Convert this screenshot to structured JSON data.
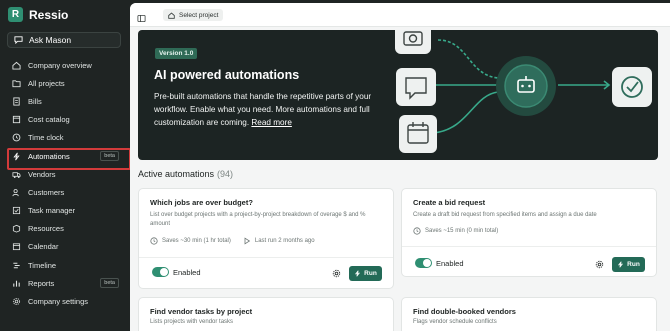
{
  "app": {
    "name": "Ressio",
    "logo_letter": "R",
    "accent": "#2f8f72"
  },
  "ask": {
    "label": "Ask Mason",
    "icon": "chat-icon"
  },
  "sidebar": {
    "items": [
      {
        "label": "Company overview",
        "icon": "home-icon"
      },
      {
        "label": "All projects",
        "icon": "folder-icon"
      },
      {
        "label": "Bills",
        "icon": "receipt-icon"
      },
      {
        "label": "Cost catalog",
        "icon": "book-icon"
      },
      {
        "label": "Time clock",
        "icon": "clock-icon"
      },
      {
        "label": "Automations",
        "icon": "bolt-icon",
        "badge": "beta",
        "active": true
      },
      {
        "label": "Vendors",
        "icon": "truck-icon"
      },
      {
        "label": "Customers",
        "icon": "users-icon"
      },
      {
        "label": "Task manager",
        "icon": "checklist-icon"
      },
      {
        "label": "Resources",
        "icon": "box-icon"
      },
      {
        "label": "Calendar",
        "icon": "calendar-icon"
      },
      {
        "label": "Timeline",
        "icon": "timeline-icon"
      },
      {
        "label": "Reports",
        "icon": "chart-icon",
        "badge": "beta"
      },
      {
        "label": "Company settings",
        "icon": "gear-icon"
      }
    ]
  },
  "topbar": {
    "select_project": "Select project"
  },
  "hero": {
    "version": "Version 1.0",
    "title": "AI powered automations",
    "description": "Pre-built automations that handle the repetitive parts of your workflow. Enable what you need. More automations and full customization are coming.",
    "link": "Read more"
  },
  "section": {
    "title": "Active automations",
    "count": "(94)"
  },
  "cards": [
    {
      "title": "Which jobs are over budget?",
      "description": "List over budget projects with a project-by-project breakdown of overage $ and % amount",
      "saves": "Saves ~30 min (1 hr total)",
      "last_run": "Last run 2 months ago",
      "status": "Enabled",
      "run_label": "Run"
    },
    {
      "title": "Create a bid request",
      "description": "Create a draft bid request from specified items and assign a due date",
      "saves": "Saves ~15 min (0 min total)",
      "status": "Enabled",
      "run_label": "Run"
    },
    {
      "title": "Find vendor tasks by project",
      "description": "Lists projects with vendor tasks"
    },
    {
      "title": "Find double-booked vendors",
      "description": "Flags vendor schedule conflicts"
    }
  ]
}
